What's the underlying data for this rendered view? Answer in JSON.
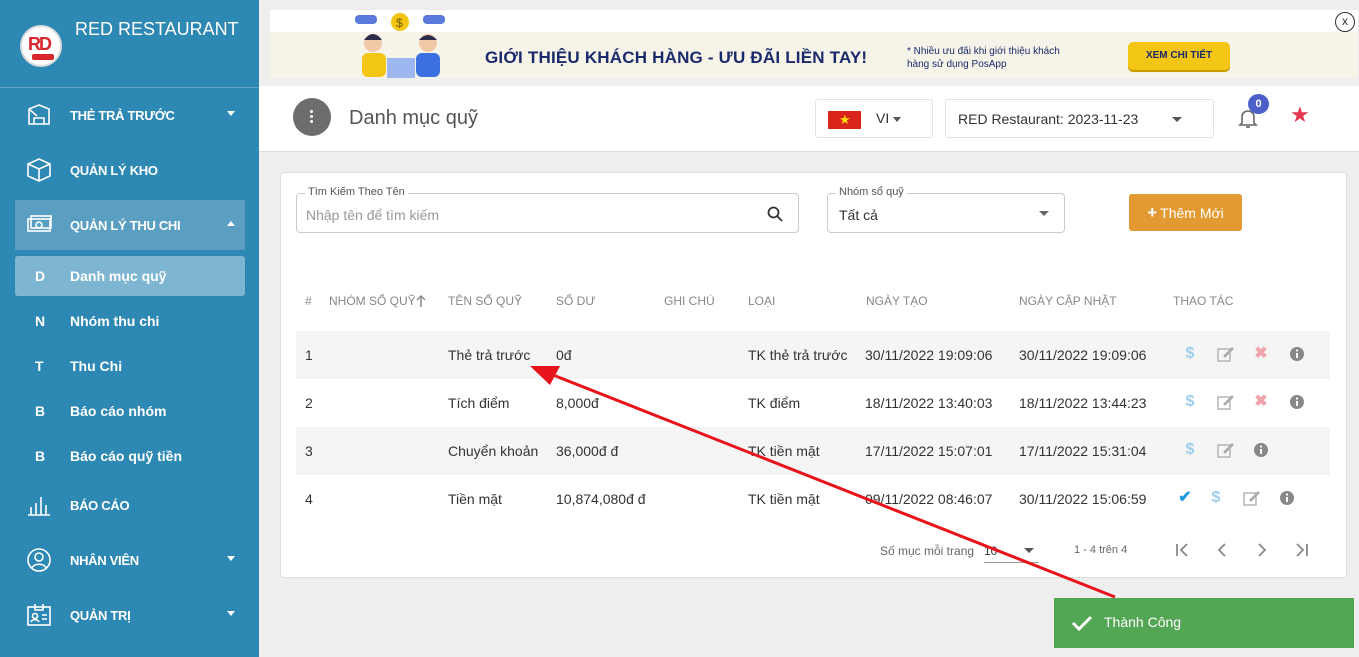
{
  "sidebar": {
    "brand": "RED RESTAURANT",
    "logo_text": "RD",
    "items": [
      {
        "label": "THẺ TRẢ TRƯỚC",
        "icon": "prepaid-card-icon"
      },
      {
        "label": "QUẢN LÝ KHO",
        "icon": "box-icon"
      },
      {
        "label": "QUẢN LÝ THU CHI",
        "icon": "money-icon"
      },
      {
        "label": "BÁO CÁO",
        "icon": "bar-chart-icon"
      },
      {
        "label": "NHÂN VIÊN",
        "icon": "user-icon"
      },
      {
        "label": "QUẢN TRỊ",
        "icon": "admin-card-icon"
      }
    ],
    "sub_items": [
      {
        "letter": "D",
        "label": "Danh mục quỹ"
      },
      {
        "letter": "N",
        "label": "Nhóm thu chi"
      },
      {
        "letter": "T",
        "label": "Thu Chi"
      },
      {
        "letter": "B",
        "label": "Báo cáo nhóm"
      },
      {
        "letter": "B",
        "label": "Báo cáo quỹ tiền"
      }
    ]
  },
  "banner": {
    "title": "GIỚI THIỆU KHÁCH HÀNG - ƯU ĐÃI LIỀN TAY!",
    "note": "* Nhiều ưu đãi khi giới thiệu khách hàng sử dụng PosApp",
    "button": "XEM CHI TIẾT",
    "close": "x"
  },
  "header": {
    "title": "Danh mục quỹ",
    "language": "VI",
    "restaurant": "RED Restaurant: 2023-11-23",
    "notification_count": "0"
  },
  "filters": {
    "search_label": "Tìm Kiếm Theo Tên",
    "search_placeholder": "Nhập tên để tìm kiếm",
    "group_label": "Nhóm sổ quỹ",
    "group_value": "Tất cả",
    "add_button": "Thêm Mới"
  },
  "table": {
    "headers": [
      "#",
      "NHÓM SỔ QUỸ",
      "TÊN SỔ QUỸ",
      "SỐ DƯ",
      "GHI CHÚ",
      "LOẠI",
      "NGÀY TẠO",
      "NGÀY CẬP NHẬT",
      "THAO TÁC"
    ],
    "rows": [
      {
        "no": "1",
        "group": "",
        "name": "Thẻ trả trước",
        "balance": "0đ",
        "note": "",
        "type": "TK thẻ trả trước",
        "created": "30/11/2022 19:09:06",
        "updated": "30/11/2022 19:09:06"
      },
      {
        "no": "2",
        "group": "",
        "name": "Tích điểm",
        "balance": "8,000đ",
        "note": "",
        "type": "TK điểm",
        "created": "18/11/2022 13:40:03",
        "updated": "18/11/2022 13:44:23"
      },
      {
        "no": "3",
        "group": "",
        "name": "Chuyển khoản",
        "balance": "36,000đ đ",
        "note": "",
        "type": "TK tiền mặt",
        "created": "17/11/2022 15:07:01",
        "updated": "17/11/2022 15:31:04"
      },
      {
        "no": "4",
        "group": "",
        "name": "Tiền mặt",
        "balance": "10,874,080đ đ",
        "note": "",
        "type": "TK tiền mặt",
        "created": "09/11/2022 08:46:07",
        "updated": "30/11/2022 15:06:59"
      }
    ]
  },
  "pagination": {
    "per_page_label": "Số mục mỗi trang",
    "per_page": "10",
    "range": "1 - 4 trên 4"
  },
  "toast": {
    "message": "Thành Công"
  },
  "colors": {
    "sidebar": "#2e88b4",
    "accent": "#e49a33",
    "toast": "#53a653",
    "annotation_arrow": "#e8141b"
  }
}
